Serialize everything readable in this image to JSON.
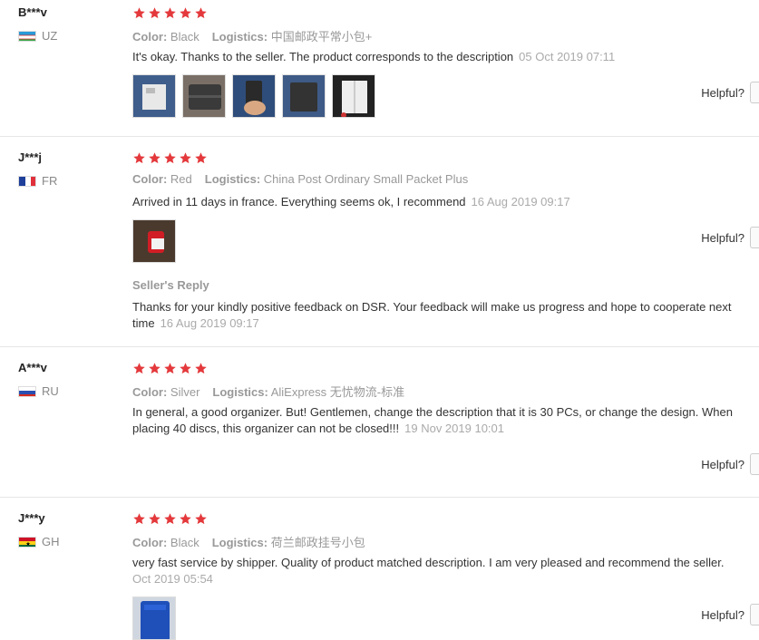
{
  "helpful_label": "Helpful?",
  "color_label": "Color:",
  "logistics_label": "Logistics:",
  "seller_reply_label": "Seller's Reply",
  "colors": {
    "star": "#e4393c",
    "muted": "#999999"
  },
  "rating_stars": 5,
  "reviews": [
    {
      "user": "B***v",
      "country": "UZ",
      "color": "Black",
      "logistics": "中国邮政平常小包+",
      "text": "It's okay. Thanks to the seller. The product corresponds to the description",
      "date": "05 Oct 2019 07:11",
      "photos": [
        "jeans-pocket-photo",
        "organizer-cover-photo",
        "hand-holding-organizer-photo",
        "organizer-on-jeans-photo",
        "organizer-open-pages-photo"
      ]
    },
    {
      "user": "J***j",
      "country": "FR",
      "color": "Red",
      "logistics": "China Post Ordinary Small Packet Plus",
      "text": "Arrived in 11 days in france. Everything seems ok, I recommend",
      "date": "16 Aug 2019 09:17",
      "photos": [
        "red-organizer-photo"
      ],
      "seller_reply": {
        "text": "Thanks for your kindly positive feedback on DSR. Your feedback will make us progress and hope to cooperate next time",
        "date": "16 Aug 2019 09:17"
      }
    },
    {
      "user": "A***v",
      "country": "RU",
      "color": "Silver",
      "logistics": "AliExpress 无忧物流-标准",
      "text": "In general, a good organizer. But! Gentlemen, change the description that it is 30 PCs, or change the design. When placing 40 discs, this organizer can not be closed!!!",
      "date": "19 Nov 2019 10:01",
      "photos": []
    },
    {
      "user": "J***y",
      "country": "GH",
      "color": "Black",
      "logistics": "荷兰邮政挂号小包",
      "text": "very fast service by shipper. Quality of product matched description. I am very pleased and recommend the seller.",
      "date": "Oct 2019 05:54",
      "photos": [
        "blue-organizer-photo"
      ]
    }
  ]
}
